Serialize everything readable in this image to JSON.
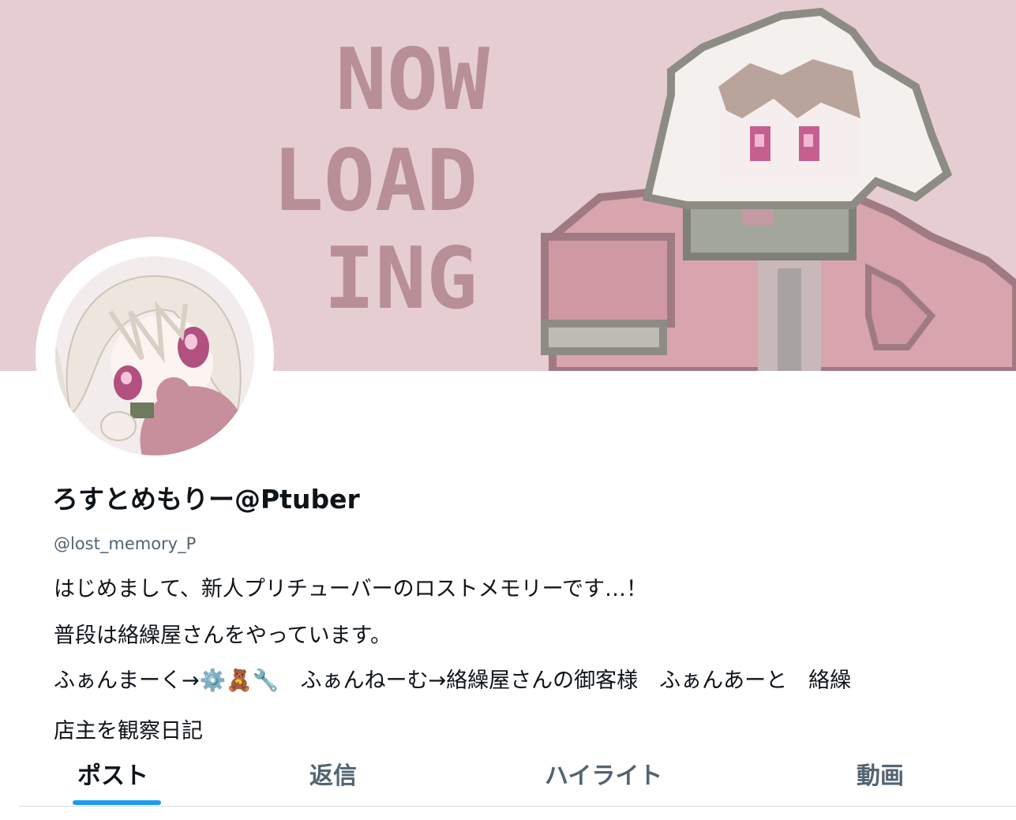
{
  "colors": {
    "banner_background": "#e6cdd2",
    "banner_text": "#b88f97",
    "coat": "#d8a4ae",
    "outline": "#8c8c84",
    "text_primary": "#0f1419",
    "text_secondary": "#536471",
    "accent": "#1d9bf0"
  },
  "banner": {
    "lines": [
      "NOW",
      "LOAD",
      "ING"
    ]
  },
  "profile": {
    "display_name": "ろすとめもりー@Ptuber",
    "handle": "@lost_memory_P",
    "bio": [
      "はじめまして、新人プリチューバーのロストメモリーです…！",
      "普段は絡繰屋さんをやっています。",
      "ふぁんまーく→⚙️🧸🔧　ふぁんねーむ→絡繰屋さんの御客様　ふぁんあーと　絡繰",
      "店主を観察日記"
    ]
  },
  "tabs": [
    {
      "label": "ポスト",
      "active": true
    },
    {
      "label": "返信",
      "active": false
    },
    {
      "label": "ハイライト",
      "active": false
    },
    {
      "label": "動画",
      "active": false
    }
  ]
}
